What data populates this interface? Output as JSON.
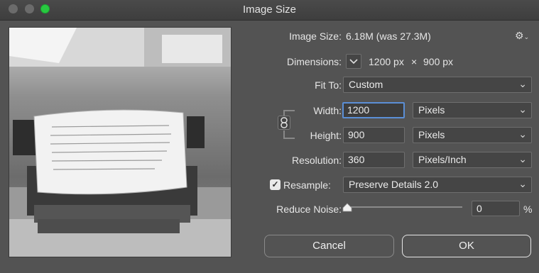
{
  "window": {
    "title": "Image Size"
  },
  "image_size": {
    "label": "Image Size:",
    "value": "6.18M (was 27.3M)"
  },
  "dimensions": {
    "label": "Dimensions:",
    "width": "1200 px",
    "times": "×",
    "height": "900 px"
  },
  "fit_to": {
    "label": "Fit To:",
    "value": "Custom"
  },
  "width": {
    "label": "Width:",
    "value": "1200",
    "unit": "Pixels"
  },
  "height": {
    "label": "Height:",
    "value": "900",
    "unit": "Pixels"
  },
  "resolution": {
    "label": "Resolution:",
    "value": "360",
    "unit": "Pixels/Inch"
  },
  "resample": {
    "label": "Resample:",
    "checked": true,
    "method": "Preserve Details 2.0"
  },
  "reduce_noise": {
    "label": "Reduce Noise:",
    "value": "0",
    "unit": "%",
    "level_fraction": 0
  },
  "buttons": {
    "cancel": "Cancel",
    "ok": "OK"
  },
  "colors": {
    "background": "#535353",
    "focus": "#5b8fd6",
    "close_button": "#28c840"
  },
  "icons": {
    "settings": "gear-icon",
    "link": "chain-link-icon",
    "chevron": "chevron-down-icon"
  }
}
